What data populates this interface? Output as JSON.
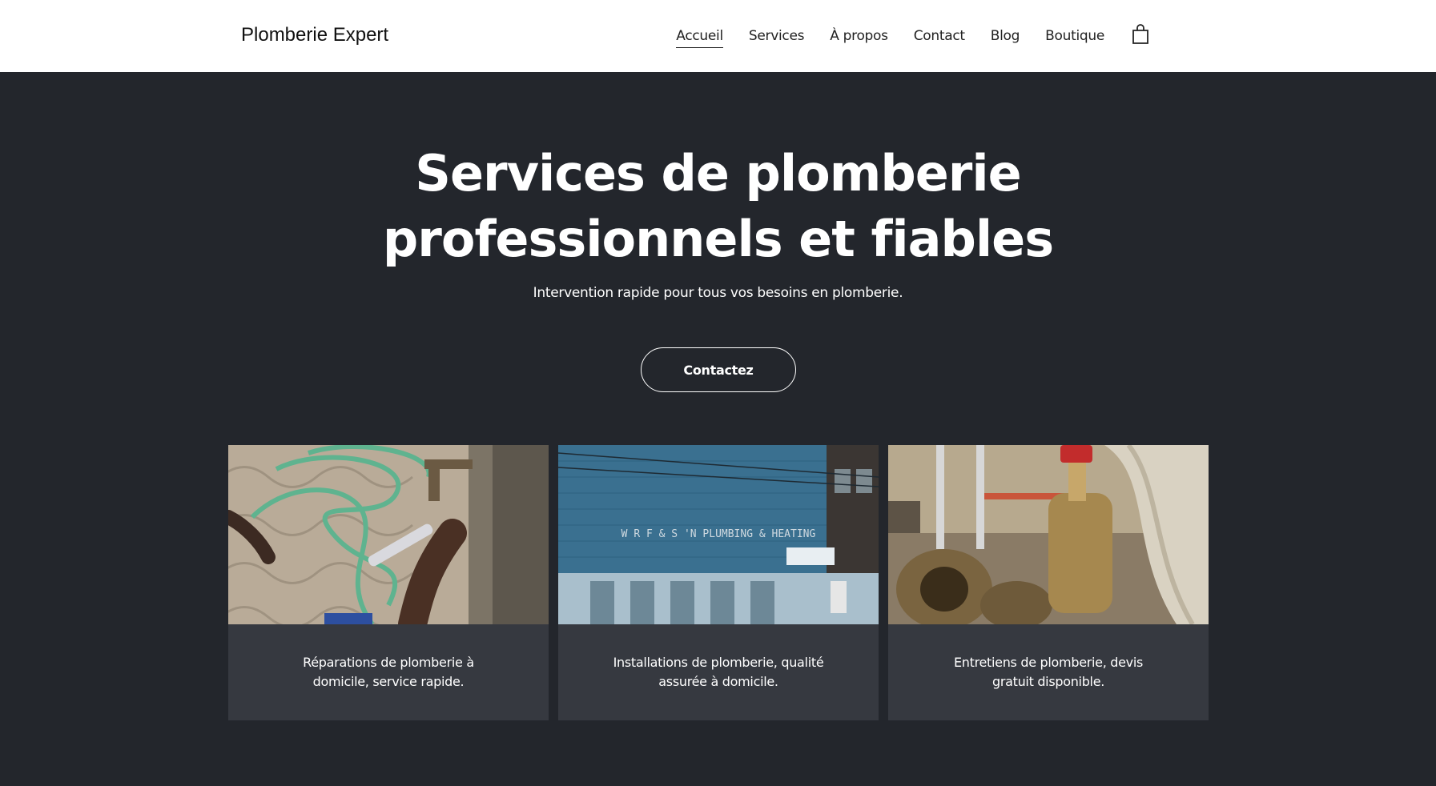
{
  "header": {
    "logo": "Plomberie Expert",
    "nav": [
      "Accueil",
      "Services",
      "À propos",
      "Contact",
      "Blog",
      "Boutique"
    ],
    "active": "Accueil",
    "cart_icon": "shopping-bag-icon"
  },
  "hero": {
    "title_line1": "Services de plomberie",
    "title_line2": "professionnels et fiables",
    "subtitle": "Intervention rapide pour tous vos besoins en plomberie.",
    "cta": "Contactez"
  },
  "cards": [
    {
      "caption_line1": "Réparations de plomberie à",
      "caption_line2": "domicile, service rapide."
    },
    {
      "caption_line1": "Installations de plomberie, qualité",
      "caption_line2": "assurée à domicile.",
      "sign_text": "W R F & S 'N PLUMBING & HEATING"
    },
    {
      "caption_line1": "Entretiens de plomberie, devis",
      "caption_line2": "gratuit disponible."
    }
  ],
  "colors": {
    "background": "#23262c",
    "card": "#363940",
    "header": "#ffffff"
  }
}
